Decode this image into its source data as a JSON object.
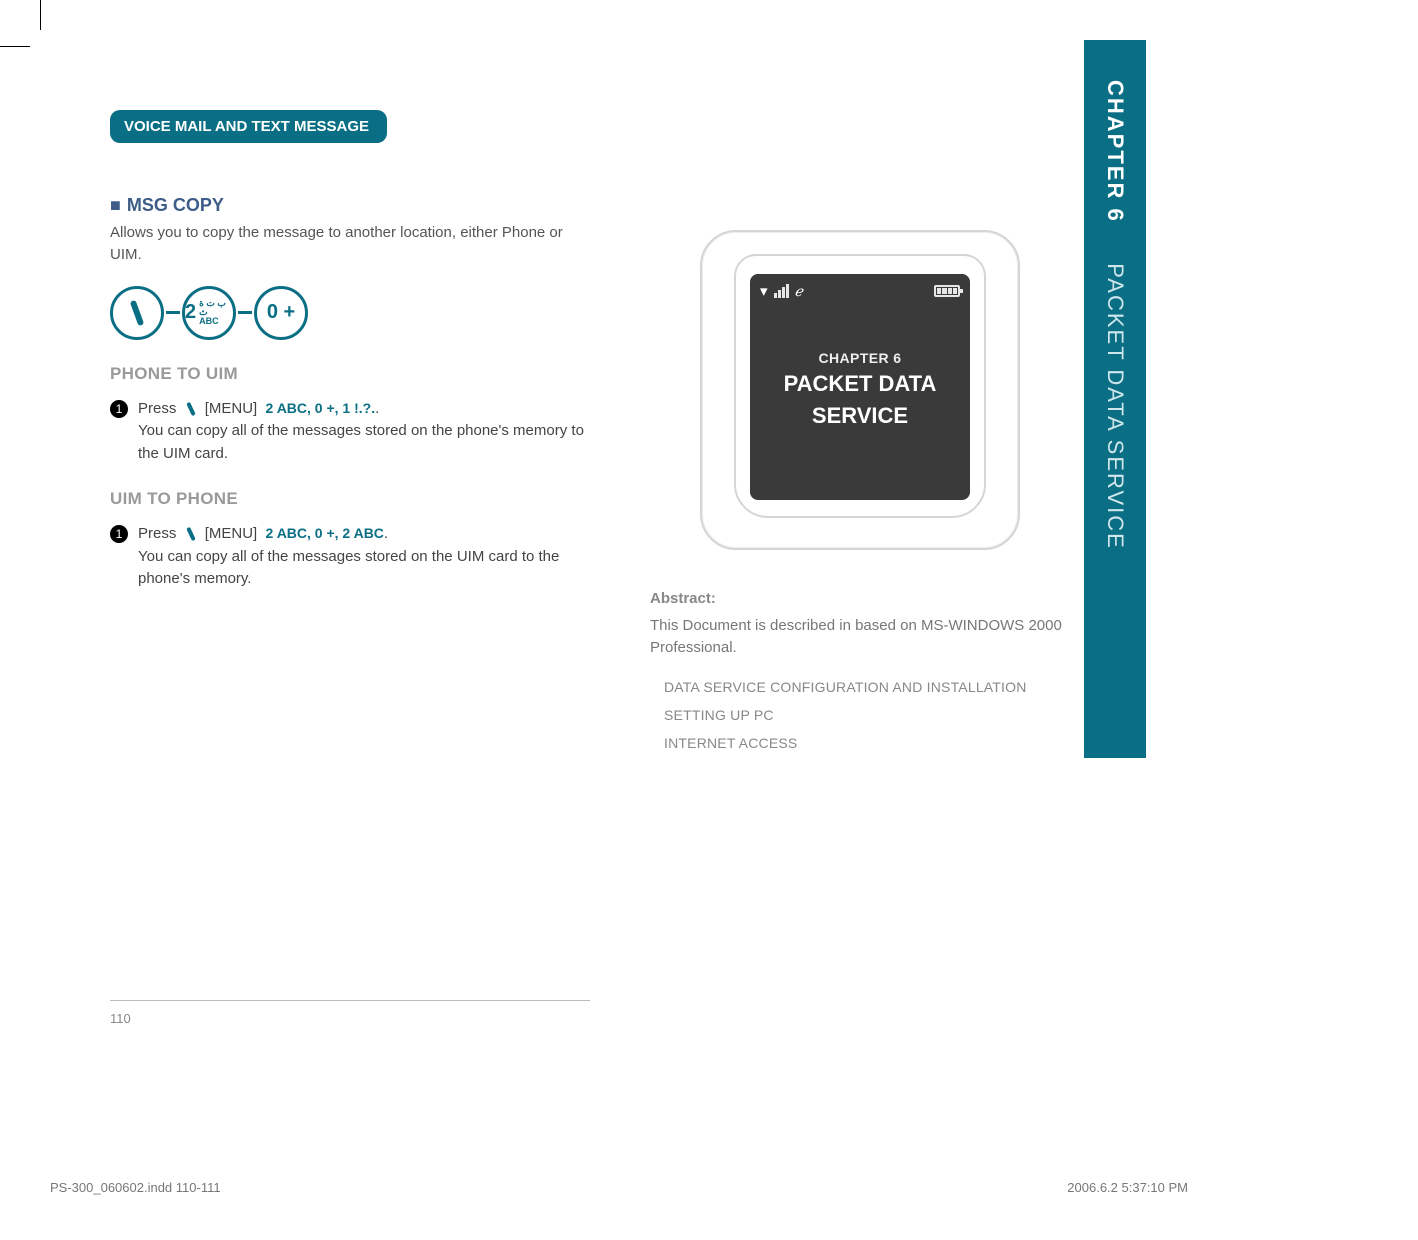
{
  "left": {
    "badge": "VOICE MAIL AND TEXT MESSAGE",
    "msg_copy_head": "MSG COPY",
    "msg_copy_desc": "Allows you to copy the message to another location, either Phone or UIM.",
    "key_row": {
      "k2": "2",
      "k2_sub_top": "ب ت ة ث",
      "k2_sub_bot": "ABC",
      "k0": "0  +"
    },
    "phone_to_uim": {
      "title": "PHONE TO UIM",
      "step_prefix": "Press",
      "menu": "[MENU]",
      "keys": "2 ABC,  0 +,  1 !.?.",
      "period": ".",
      "body": "You can copy all of the messages stored on the phone's memory to the UIM card."
    },
    "uim_to_phone": {
      "title": "UIM TO PHONE",
      "step_prefix": "Press",
      "menu": "[MENU]",
      "keys": "2 ABC,  0 +,  2 ABC",
      "period": ".",
      "body": "You can copy all of the messages stored on the UIM card to the phone's memory."
    },
    "page_number": "110"
  },
  "right": {
    "chapter_num": "CHAPTER 6",
    "chapter_title_1": "PACKET DATA",
    "chapter_title_2": "SERVICE",
    "abstract_head": "Abstract:",
    "abstract_body": "This Document is described in based on MS-WINDOWS 2000 Professional.",
    "list": [
      "DATA SERVICE CONFIGURATION AND INSTALLATION",
      "SETTING UP PC",
      "INTERNET ACCESS"
    ]
  },
  "side": {
    "chapter": "CHAPTER 6",
    "title": "PACKET DATA SERVICE"
  },
  "footer": {
    "left": "PS-300_060602.indd   110-111",
    "right": "2006.6.2   5:37:10 PM"
  }
}
